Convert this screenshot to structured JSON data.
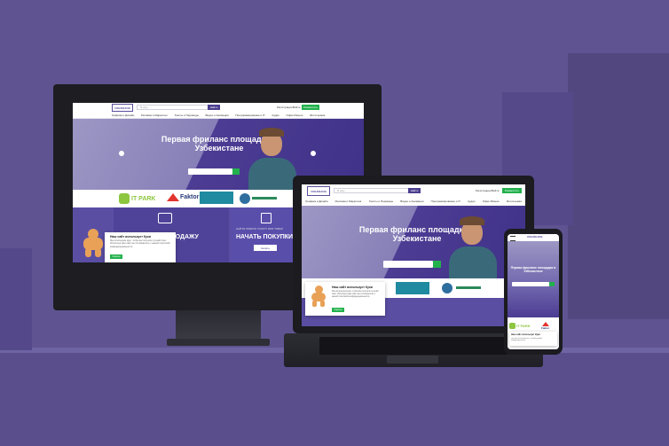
{
  "site": {
    "logo": "ONLINEJOB",
    "search_placeholder": "Я ищу ...",
    "search_button": "Найти",
    "login": "Регистрация",
    "signin": "Войти",
    "register": "Разместить",
    "categories": [
      "Графика и Дизайн",
      "Реклама и Маркетинг",
      "Тексты и Переводы",
      "Видео и Анимация",
      "Программирование и IT",
      "Аудио",
      "Офис-Разное",
      "Фотосъемка"
    ],
    "hero_title_line1": "Первая фриланс площадка в",
    "hero_title_line2": "Узбекистане",
    "partners": [
      "IT PARK",
      "Faktor"
    ],
    "tile_left": "ПРОДАЖУ",
    "tile_right_small": "НАЙТИ ЛЮБУЮ УСЛУГУ ИЛИ ТОВАР",
    "tile_right_big": "НАЧАТЬ ПОКУПКИ",
    "tile_right_button": "Начать",
    "cookie_title": "Наш сайт использует Куки",
    "cookie_text": "Мы используем куки, чтобы вы получили лучший опыт. Используя наш сайт, вы соглашаетесь с нашей политикой конфиденциальности.",
    "cookie_button": "Хорошо"
  },
  "colors": {
    "background": "#5f5491",
    "brand_purple": "#4b3f8f",
    "brand_green": "#22b14c"
  }
}
